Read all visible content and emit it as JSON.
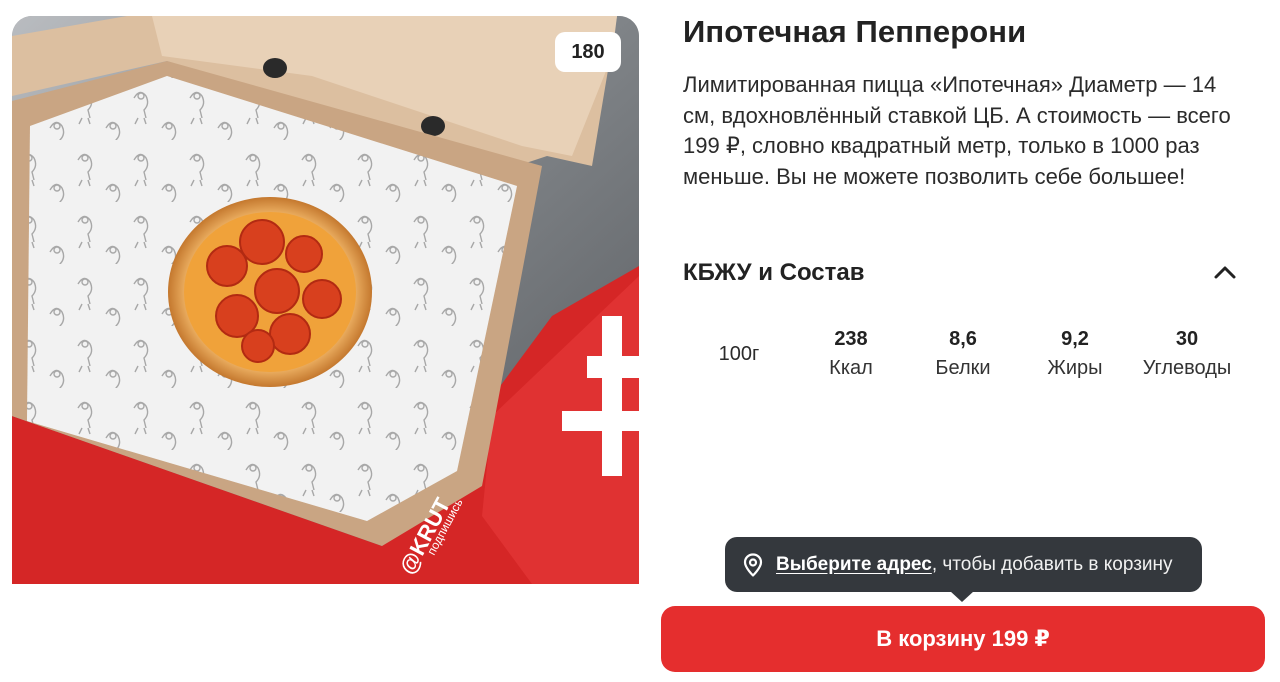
{
  "product": {
    "weight_badge": "180",
    "title": "Ипотечная Пепперони",
    "description": "Лимитированная пицца «Ипотечная» Диаметр — 14 см, вдохновлённый ставкой ЦБ. А стоимость — всего 199 ₽, словно квадратный метр, только в 1000 раз меньше. Вы не можете позволить себе большее!"
  },
  "nutrition_section": {
    "title": "КБЖУ и Состав",
    "expanded": true,
    "portion": "100г",
    "items": [
      {
        "value": "238",
        "label": "Ккал"
      },
      {
        "value": "8,6",
        "label": "Белки"
      },
      {
        "value": "9,2",
        "label": "Жиры"
      },
      {
        "value": "30",
        "label": "Углеводы"
      }
    ]
  },
  "tooltip": {
    "link_text": "Выберите адрес",
    "text": ", чтобы добавить в корзину"
  },
  "cart_button": {
    "label": "В корзину 199 ₽"
  },
  "image": {
    "box_print": "@KRUT",
    "box_print_2": "подпишись"
  },
  "colors": {
    "accent": "#e52e2e",
    "tooltip_bg": "#34383d",
    "text": "#222222"
  },
  "icons": [
    "location-pin-icon",
    "chevron-up-icon"
  ]
}
